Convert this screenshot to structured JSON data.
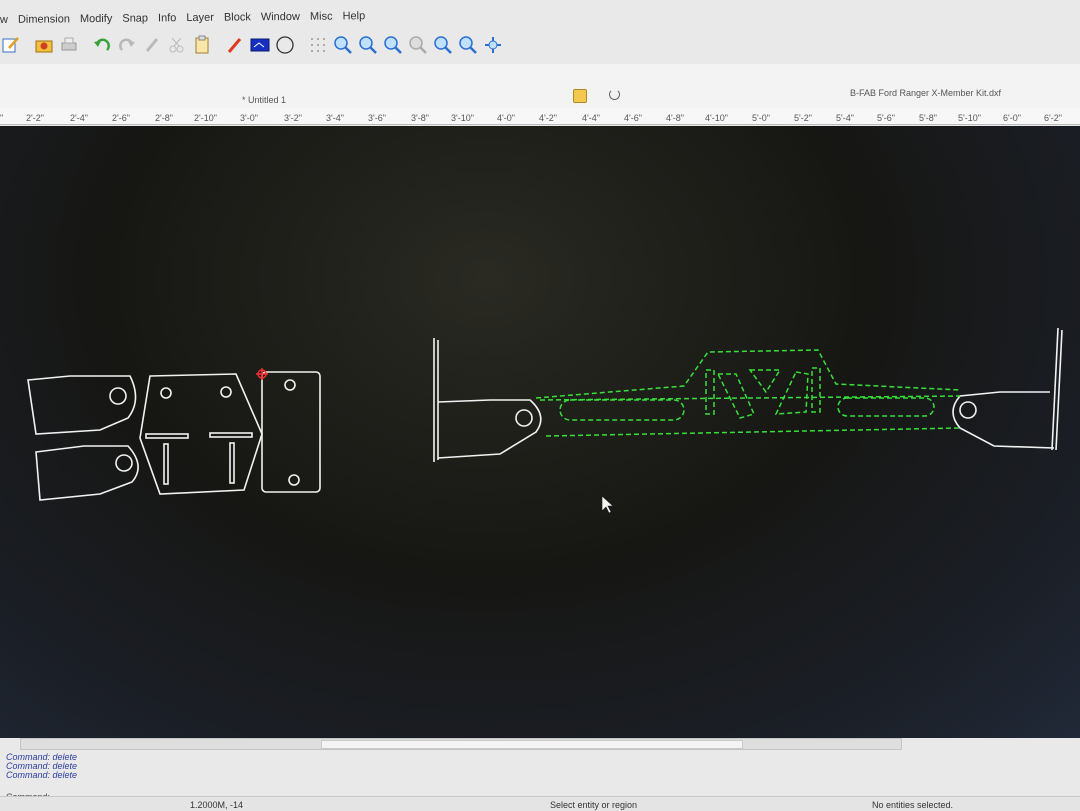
{
  "menu": {
    "items": [
      "w",
      "Dimension",
      "Modify",
      "Snap",
      "Info",
      "Layer",
      "Block",
      "Window",
      "Misc",
      "Help"
    ]
  },
  "toolbar": {
    "icons": [
      "edit-icon",
      "settings-icon",
      "print-icon",
      "undo-icon",
      "redo-icon",
      "pencil-icon",
      "cut-icon",
      "paste-icon",
      "pen-icon",
      "layer-color-icon",
      "circle-icon",
      "grid-icon",
      "zoom-in-icon",
      "zoom-out-icon",
      "zoom-auto-icon",
      "zoom-window-icon",
      "zoom-previous-icon",
      "zoom-selection-icon",
      "pan-icon"
    ]
  },
  "tabs": {
    "untitled": "* Untitled 1",
    "file": "B-FAB Ford Ranger X-Member Kit.dxf"
  },
  "ruler": {
    "ticks": [
      "\"",
      "2'-2\"",
      "2'-4\"",
      "2'-6\"",
      "2'-8\"",
      "2'-10\"",
      "3'-0\"",
      "3'-2\"",
      "3'-4\"",
      "3'-6\"",
      "3'-8\"",
      "3'-10\"",
      "4'-0\"",
      "4'-2\"",
      "4'-4\"",
      "4'-6\"",
      "4'-8\"",
      "4'-10\"",
      "5'-0\"",
      "5'-2\"",
      "5'-4\"",
      "5'-6\"",
      "5'-8\"",
      "5'-10\"",
      "6'-0\"",
      "6'-2\""
    ]
  },
  "command": {
    "history": [
      "Command: delete",
      "Command: delete",
      "Command: delete"
    ],
    "prompt": "Command:"
  },
  "status": {
    "coords": "1.2000M, -14",
    "hint": "Select entity or region",
    "selection": "No entities selected."
  },
  "colors": {
    "drawing_white": "#f2f2f2",
    "drawing_green": "#37e13a",
    "cursor_red": "#ff3030"
  }
}
